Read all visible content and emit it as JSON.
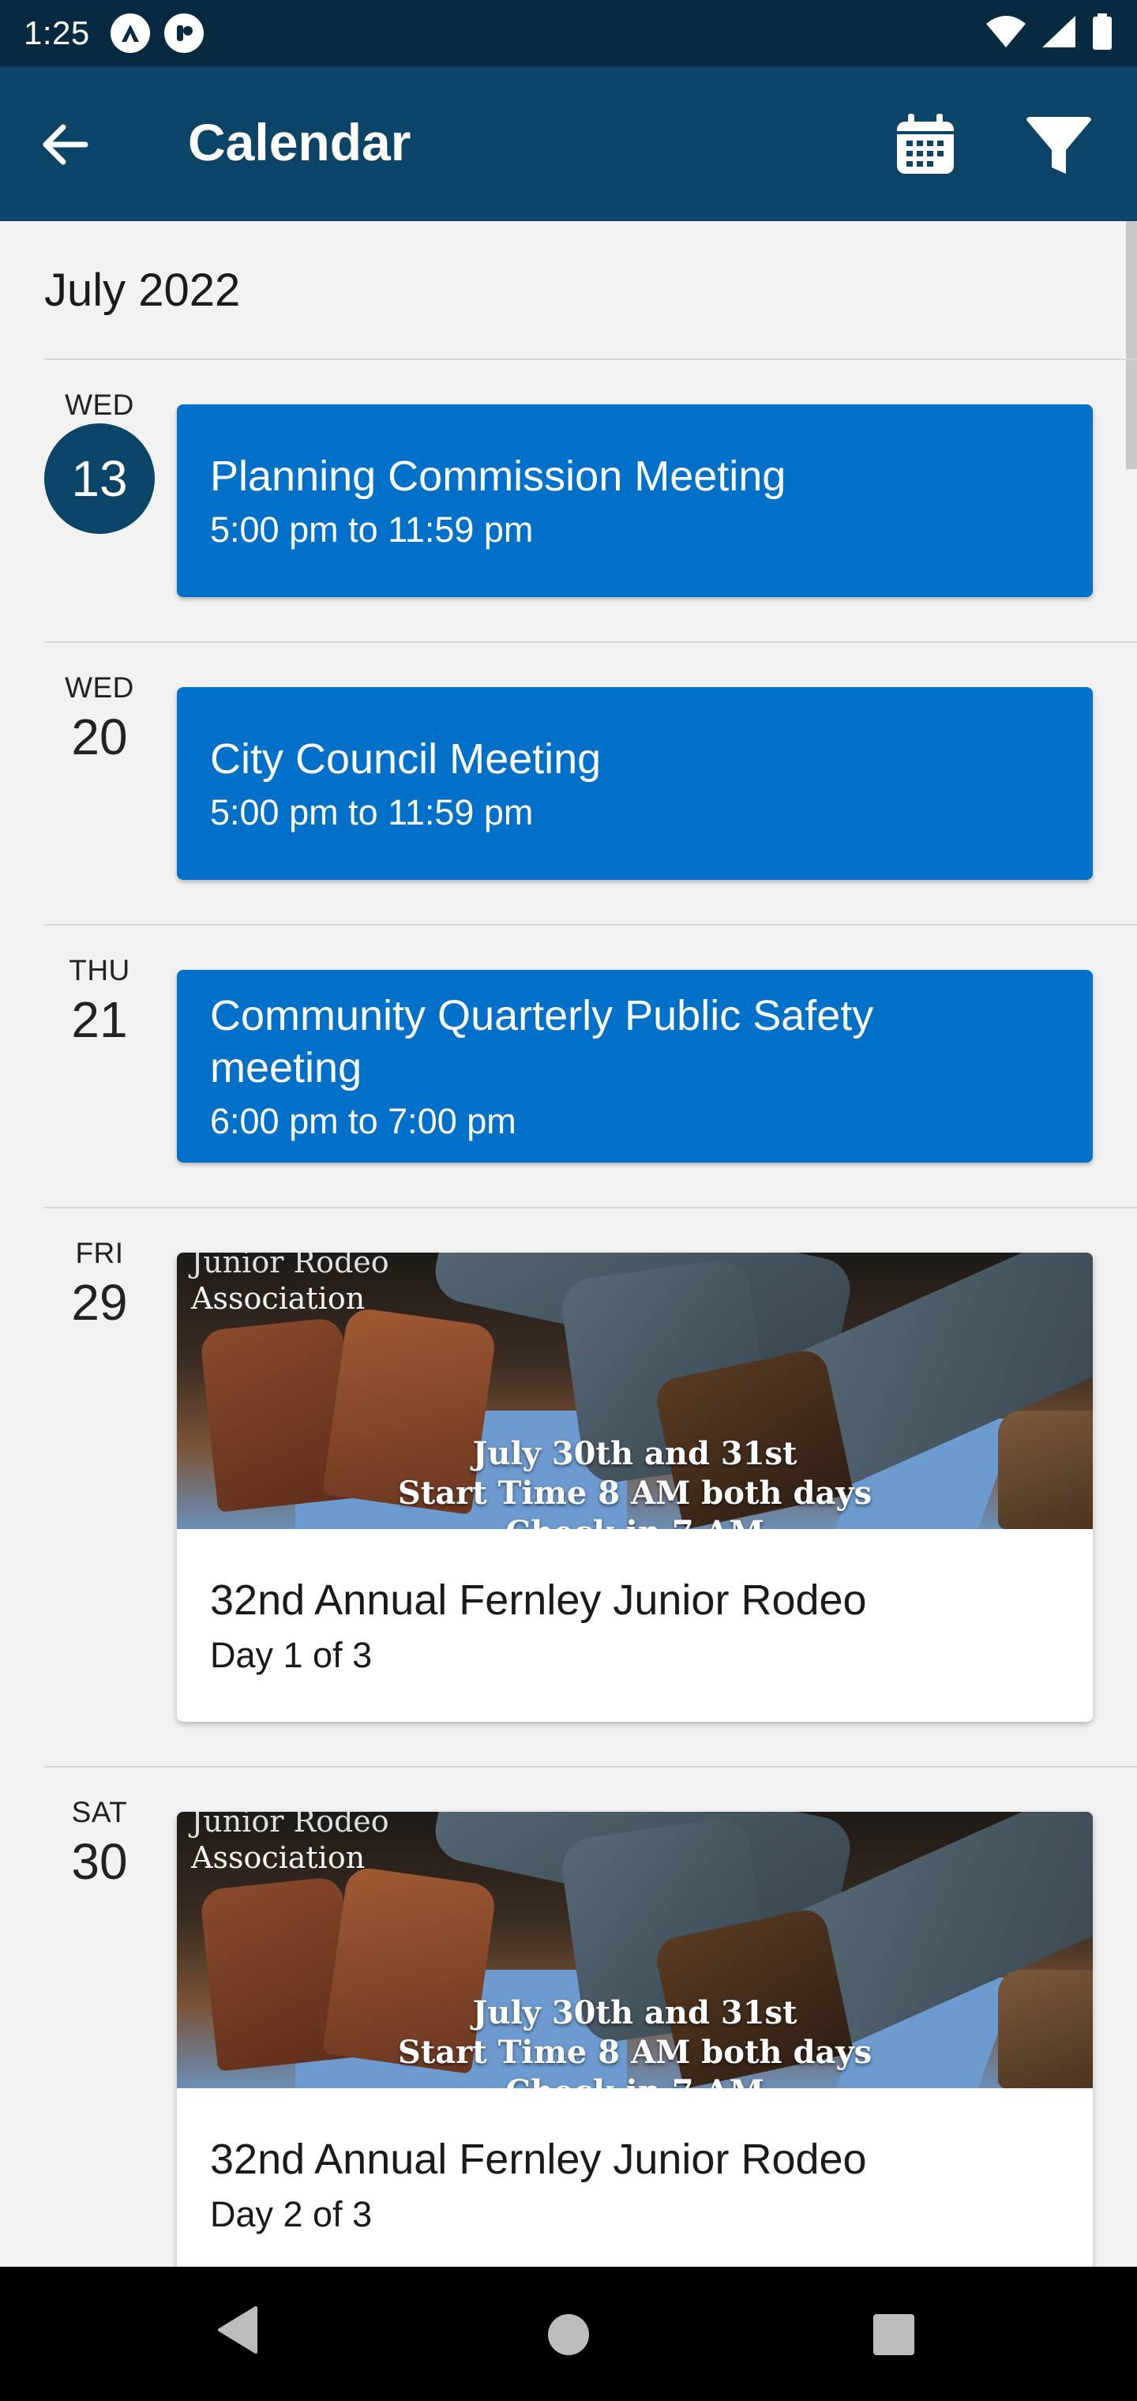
{
  "status_bar": {
    "time": "1:25",
    "icons": [
      "app-a-icon",
      "app-badge-icon",
      "wifi-icon",
      "signal-icon",
      "battery-icon"
    ]
  },
  "app_bar": {
    "title": "Calendar",
    "back_icon": "arrow-left-icon",
    "calendar_icon": "calendar-icon",
    "filter_icon": "filter-icon"
  },
  "month": "July 2022",
  "colors": {
    "app_bar": "#0b4466",
    "status_bar": "#082a40",
    "event_card": "#0070c9"
  },
  "days": [
    {
      "dow": "WED",
      "day": "13",
      "today": true,
      "event": {
        "title": "Planning Commission Meeting",
        "time": "5:00 pm to 11:59 pm"
      }
    },
    {
      "dow": "WED",
      "day": "20",
      "today": false,
      "event": {
        "title": "City Council Meeting",
        "time": "5:00 pm to 11:59 pm"
      }
    },
    {
      "dow": "THU",
      "day": "21",
      "today": false,
      "event": {
        "title": "Community Quarterly Public Safety meeting",
        "time": "6:00 pm to 7:00 pm"
      }
    },
    {
      "dow": "FRI",
      "day": "29",
      "today": false,
      "image_event": {
        "image_text_top_cut": "Junior Rodeo",
        "image_text_top": "Association",
        "image_line1": "July 30th and 31st",
        "image_line2": "Start Time 8 AM both days",
        "image_line3_cut": "Check in 7 AM",
        "title": "32nd Annual Fernley Junior Rodeo",
        "subtitle": "Day 1 of 3"
      }
    },
    {
      "dow": "SAT",
      "day": "30",
      "today": false,
      "image_event": {
        "image_text_top_cut": "Junior Rodeo",
        "image_text_top": "Association",
        "image_line1": "July 30th and 31st",
        "image_line2": "Start Time 8 AM both days",
        "image_line3_cut": "Check in 7 AM",
        "title": "32nd Annual Fernley Junior Rodeo",
        "subtitle": "Day 2 of 3"
      }
    }
  ],
  "nav_bar": {
    "icons": [
      "back-triangle-icon",
      "home-circle-icon",
      "recents-square-icon"
    ]
  }
}
